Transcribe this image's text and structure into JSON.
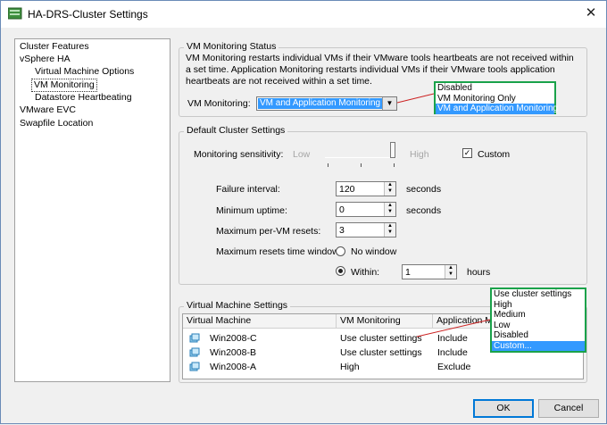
{
  "window": {
    "title": "HA-DRS-Cluster Settings"
  },
  "tree": {
    "items": [
      "Cluster Features",
      "vSphere HA",
      "Virtual Machine Options",
      "VM Monitoring",
      "Datastore Heartbeating",
      "VMware EVC",
      "Swapfile Location"
    ],
    "selected": "VM Monitoring"
  },
  "vm_monitoring_status": {
    "group_label": "VM Monitoring Status",
    "description": "VM Monitoring restarts individual VMs if their VMware tools heartbeats are not received within a set time.  Application Monitoring restarts individual VMs if their VMware tools application heartbeats are not received within a set time.",
    "field_label": "VM Monitoring:",
    "value": "VM and Application Monitoring",
    "options": [
      "Disabled",
      "VM Monitoring Only",
      "VM and Application Monitoring"
    ],
    "highlighted_option": "VM and Application Monitoring"
  },
  "default_cluster_settings": {
    "group_label": "Default Cluster Settings",
    "sensitivity_label": "Monitoring sensitivity:",
    "low_label": "Low",
    "high_label": "High",
    "custom_label": "Custom",
    "custom_checked": true,
    "failure_interval_label": "Failure interval:",
    "failure_interval_value": "120",
    "failure_interval_unit": "seconds",
    "min_uptime_label": "Minimum uptime:",
    "min_uptime_value": "0",
    "min_uptime_unit": "seconds",
    "max_resets_label": "Maximum per-VM resets:",
    "max_resets_value": "3",
    "window_label": "Maximum resets time window:",
    "no_window_label": "No window",
    "within_label": "Within:",
    "within_value": "1",
    "within_unit": "hours",
    "selected_window": "Within:"
  },
  "vm_settings": {
    "group_label": "Virtual Machine Settings",
    "columns": [
      "Virtual Machine",
      "VM Monitoring",
      "Application M"
    ],
    "rows": [
      {
        "name": "Win2008-C",
        "monitoring": "Use cluster settings",
        "app": "Include"
      },
      {
        "name": "Win2008-B",
        "monitoring": "Use cluster settings",
        "app": "Include"
      },
      {
        "name": "Win2008-A",
        "monitoring": "High",
        "app": "Exclude"
      }
    ],
    "dropdown_options": [
      "Use cluster settings",
      "High",
      "Medium",
      "Low",
      "Disabled",
      "Custom..."
    ],
    "highlighted_option": "Custom..."
  },
  "buttons": {
    "ok": "OK",
    "cancel": "Cancel"
  },
  "colors": {
    "highlight": "#3399ff",
    "annotation_border": "#1aa24a",
    "connector": "#cc2222"
  }
}
